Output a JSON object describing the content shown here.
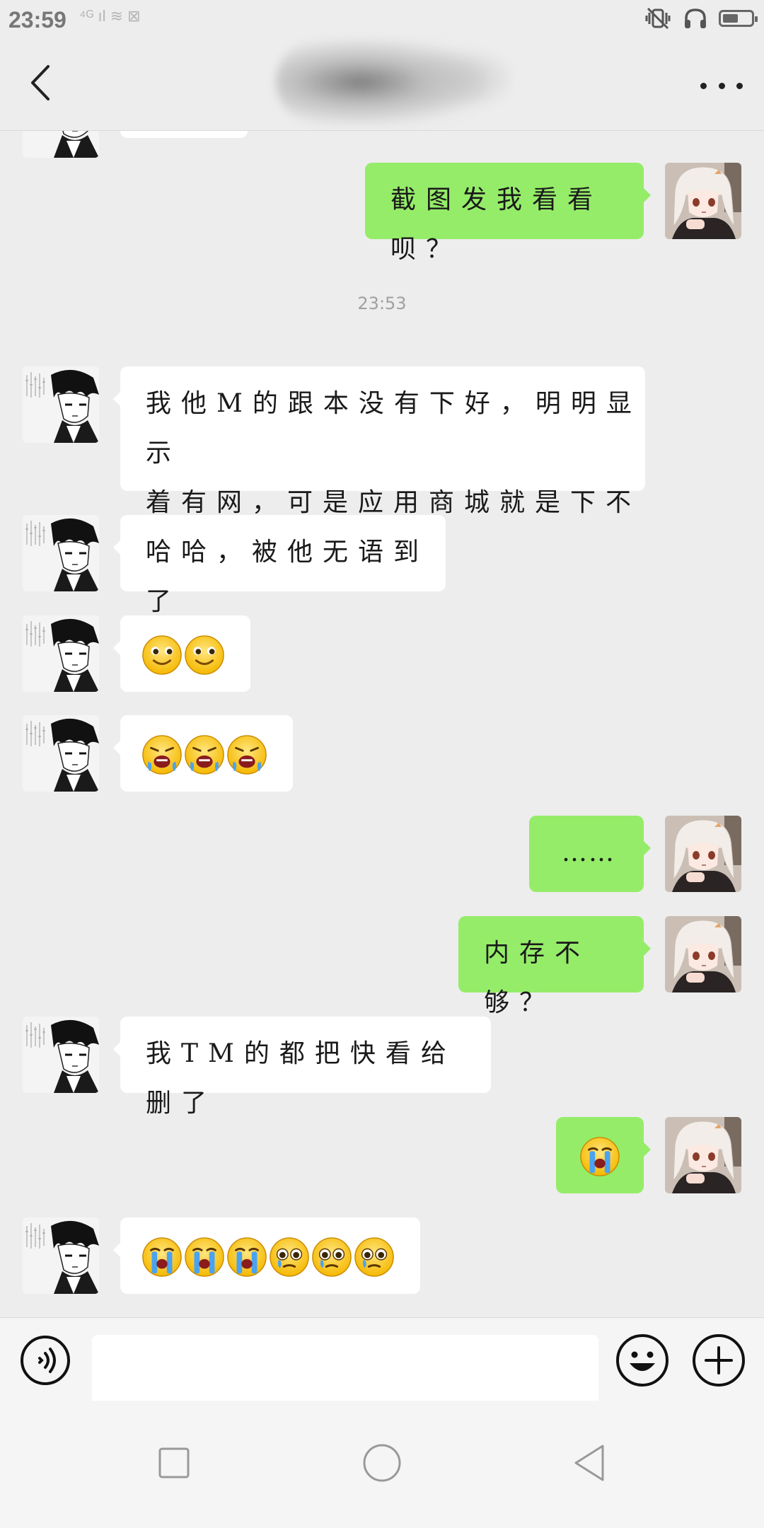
{
  "status_bar": {
    "time": "23:59",
    "left_icons": "⁴ᴳ ıl  ≋  ⊠",
    "battery_level": 0.55
  },
  "header": {
    "back_icon": "chevron-left-icon",
    "more_icon": "more-dots-icon"
  },
  "timestamp": "23:53",
  "messages": [
    {
      "side": "right",
      "text": "截图发我看看呗？"
    },
    {
      "side": "left",
      "lines": [
        "我他M的跟本没有下好，明明显示",
        "着有网，可是应用商城就是下不了。"
      ]
    },
    {
      "side": "left",
      "text": "哈哈，被他无语到了"
    },
    {
      "side": "left",
      "emojis": [
        "smile-emoji",
        "smile-emoji"
      ]
    },
    {
      "side": "left",
      "emojis": [
        "puke-emoji",
        "puke-emoji",
        "puke-emoji"
      ]
    },
    {
      "side": "right",
      "text": "……"
    },
    {
      "side": "right",
      "text": "内存不够？"
    },
    {
      "side": "left",
      "text": "我TM的都把快看给删了"
    },
    {
      "side": "right",
      "emojis": [
        "crying-emoji"
      ]
    },
    {
      "side": "left",
      "emojis": [
        "crying-emoji",
        "crying-emoji",
        "crying-emoji",
        "teary-emoji",
        "teary-emoji",
        "teary-emoji"
      ]
    }
  ],
  "input_bar": {
    "voice_icon": "voice-icon",
    "input_value": "",
    "emoji_icon": "emoji-face-icon",
    "plus_icon": "plus-icon"
  },
  "nav_bar": [
    "recent-apps-icon",
    "home-icon",
    "back-icon"
  ],
  "colors": {
    "background": "#ededed",
    "sent_bubble": "#95ec69",
    "received_bubble": "#ffffff"
  }
}
